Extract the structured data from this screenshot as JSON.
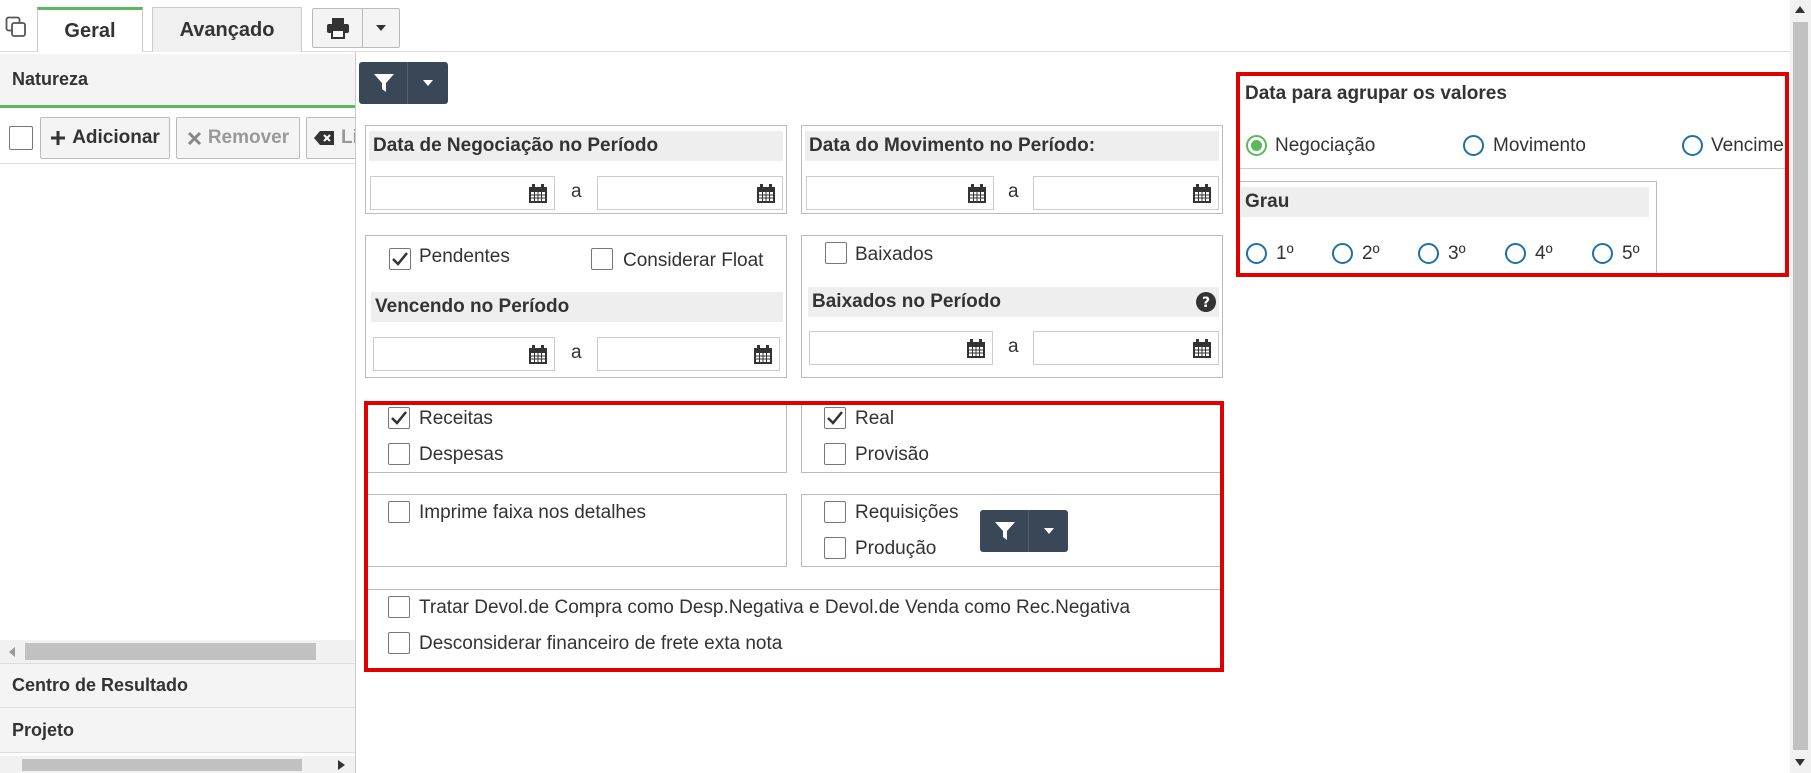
{
  "tabs": {
    "geral": "Geral",
    "avancado": "Avançado"
  },
  "left": {
    "natureza": "Natureza",
    "adicionar": "Adicionar",
    "remover": "Remover",
    "limpar": "Li",
    "centro": "Centro de Resultado",
    "projeto": "Projeto"
  },
  "negociacao": {
    "title": "Data de Negociação no Período",
    "sep": "a"
  },
  "movimento": {
    "title": "Data do Movimento no Período:",
    "sep": "a"
  },
  "pendentes": {
    "label": "Pendentes",
    "checked": true,
    "float_label": "Considerar Float",
    "vencendo": "Vencendo no Período",
    "sep": "a"
  },
  "baixados": {
    "label": "Baixados",
    "title": "Baixados no Período",
    "sep": "a"
  },
  "tipo": {
    "receitas": "Receitas",
    "despesas": "Despesas",
    "real": "Real",
    "provisao": "Provisão"
  },
  "opcoes": {
    "imprime": "Imprime faixa nos detalhes",
    "requisicoes": "Requisições",
    "producao": "Produção",
    "tratar": "Tratar Devol.de Compra como Desp.Negativa e Devol.de Venda como Rec.Negativa",
    "desconsiderar": "Desconsiderar financeiro de frete exta nota"
  },
  "agrupar": {
    "title": "Data para agrupar os valores",
    "options": [
      "Negociação",
      "Movimento",
      "Vencime"
    ],
    "selected": "Negociação"
  },
  "grau": {
    "title": "Grau",
    "options": [
      "1º",
      "2º",
      "3º",
      "4º",
      "5º"
    ]
  },
  "colors": {
    "accent_green": "#5cb85c",
    "radio_blue": "#1f6fa8",
    "highlight_red": "#e00000",
    "dark_button": "#3a4756"
  }
}
